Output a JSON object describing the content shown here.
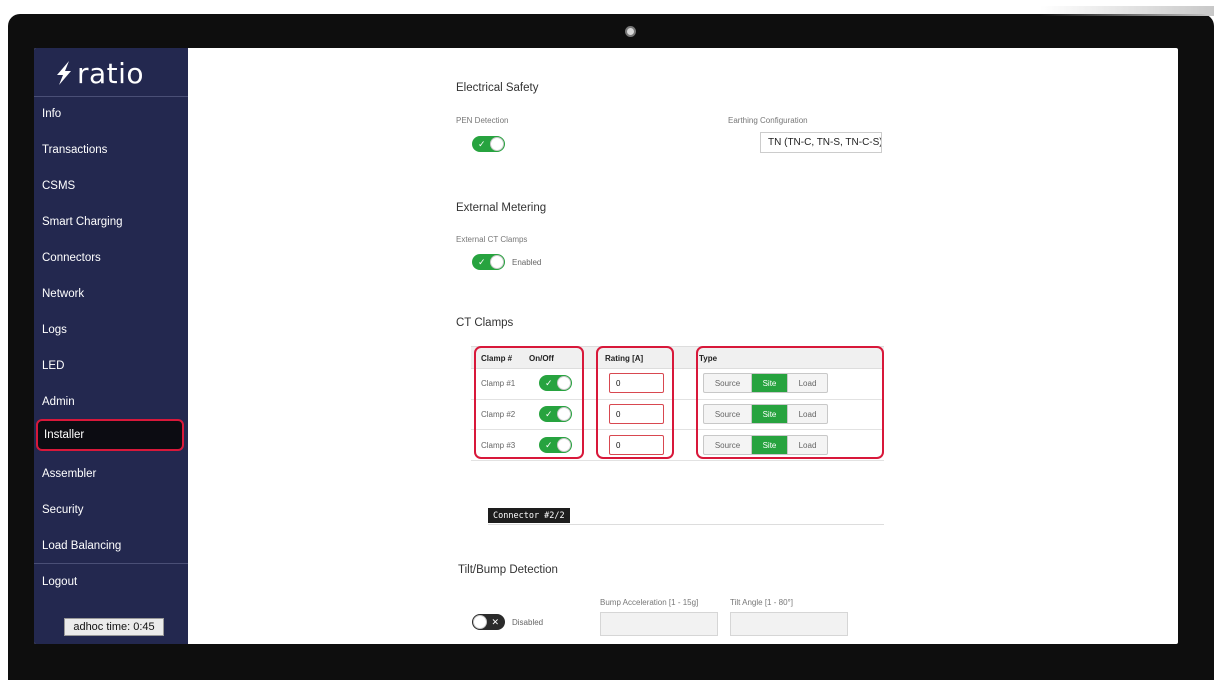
{
  "app": {
    "logo_text": "ratio",
    "logo_icon": "bolt-icon"
  },
  "sidebar": {
    "items": [
      {
        "label": "Info"
      },
      {
        "label": "Transactions"
      },
      {
        "label": "CSMS"
      },
      {
        "label": "Smart Charging"
      },
      {
        "label": "Connectors"
      },
      {
        "label": "Network"
      },
      {
        "label": "Logs"
      },
      {
        "label": "LED"
      },
      {
        "label": "Admin"
      },
      {
        "label": "Installer",
        "active": true
      },
      {
        "label": "Assembler"
      },
      {
        "label": "Security"
      },
      {
        "label": "Load Balancing"
      },
      {
        "label": "Logout"
      }
    ],
    "adhoc_time": "adhoc time: 0:45"
  },
  "electrical_safety": {
    "title": "Electrical Safety",
    "pen_detection_label": "PEN Detection",
    "pen_detection_on": true,
    "earthing_label": "Earthing Configuration",
    "earthing_value": "TN (TN-C, TN-S, TN-C-S)"
  },
  "external_metering": {
    "title": "External Metering",
    "ct_clamps_label": "External CT Clamps",
    "ct_clamps_on": true,
    "ct_clamps_state": "Enabled"
  },
  "ct_clamps": {
    "title": "CT Clamps",
    "columns": [
      "Clamp #",
      "On/Off",
      "Rating [A]",
      "Type"
    ],
    "type_options": [
      "Source",
      "Site",
      "Load"
    ],
    "rows": [
      {
        "name": "Clamp #1",
        "on": true,
        "rating": "0",
        "type": "Site"
      },
      {
        "name": "Clamp #2",
        "on": true,
        "rating": "0",
        "type": "Site"
      },
      {
        "name": "Clamp #3",
        "on": true,
        "rating": "0",
        "type": "Site"
      }
    ]
  },
  "connector": {
    "label": "Connector #2/2"
  },
  "tilt_bump": {
    "title": "Tilt/Bump Detection",
    "on": false,
    "state": "Disabled",
    "bump_label": "Bump Acceleration [1 - 15g]",
    "tilt_label": "Tilt Angle [1 - 80°]"
  },
  "colors": {
    "sidebar_bg": "#23284f",
    "toggle_on": "#27a33f",
    "highlight": "#d8183a"
  }
}
